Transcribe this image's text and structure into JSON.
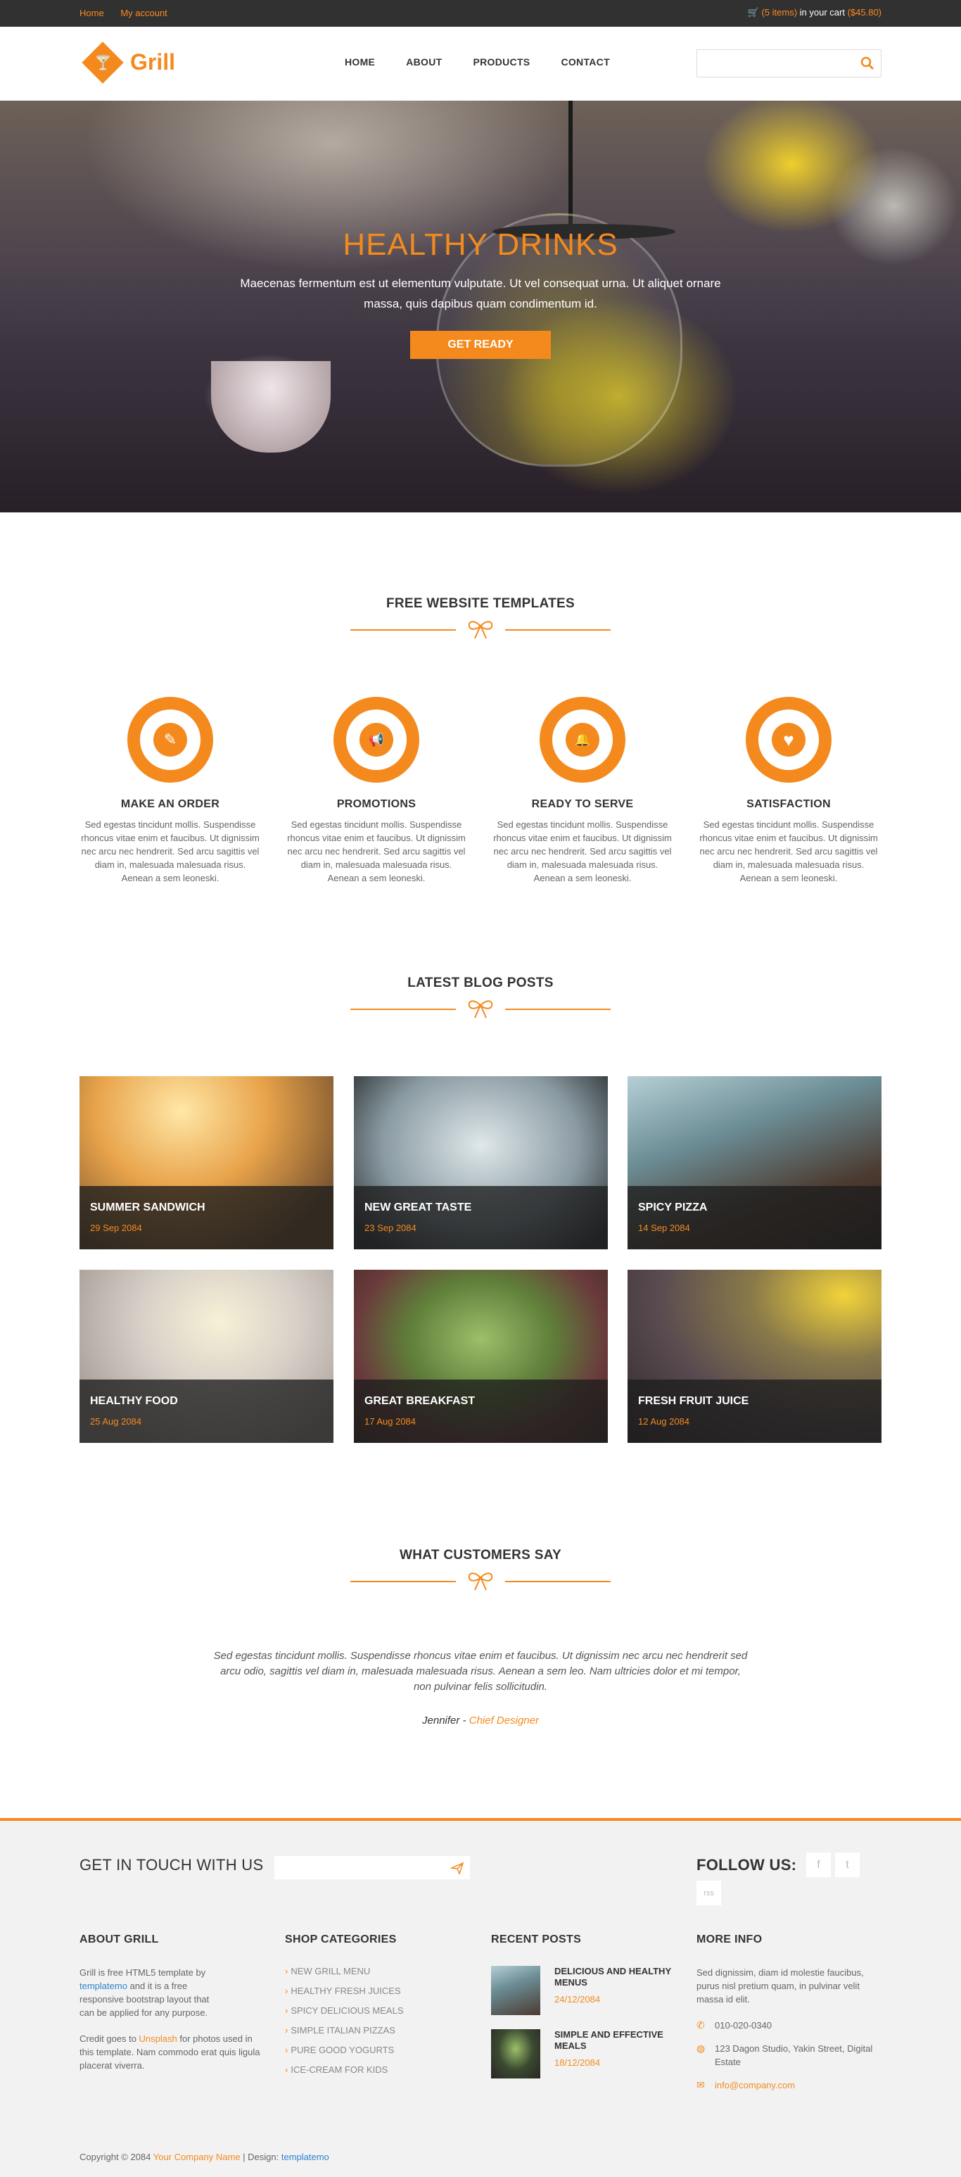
{
  "topbar": {
    "links": [
      "Home",
      "My account"
    ],
    "cart_prefix": "(5 items)",
    "cart_text": " in your cart ",
    "cart_amount": "($45.80)"
  },
  "header": {
    "logo_text": "Grill",
    "nav": [
      "HOME",
      "ABOUT",
      "PRODUCTS",
      "CONTACT"
    ],
    "search_placeholder": ""
  },
  "hero": {
    "title": "HEALTHY DRINKS",
    "text": "Maecenas fermentum est ut elementum vulputate. Ut vel consequat urna. Ut aliquet ornare massa, quis dapibus quam condimentum id.",
    "button": "GET READY"
  },
  "features": {
    "title": "FREE WEBSITE TEMPLATES",
    "items": [
      {
        "icon": "pencil-icon",
        "glyph": "✎",
        "title": "MAKE AN ORDER",
        "text": "Sed egestas tincidunt mollis. Suspendisse rhoncus vitae enim et faucibus. Ut dignissim nec arcu nec hendrerit. Sed arcu sagittis vel diam in, malesuada malesuada risus. Aenean a sem leoneski."
      },
      {
        "icon": "megaphone-icon",
        "glyph": "📢",
        "title": "PROMOTIONS",
        "text": "Sed egestas tincidunt mollis. Suspendisse rhoncus vitae enim et faucibus. Ut dignissim nec arcu nec hendrerit. Sed arcu sagittis vel diam in, malesuada malesuada risus. Aenean a sem leoneski."
      },
      {
        "icon": "bell-icon",
        "glyph": "🔔",
        "title": "READY TO SERVE",
        "text": "Sed egestas tincidunt mollis. Suspendisse rhoncus vitae enim et faucibus. Ut dignissim nec arcu nec hendrerit. Sed arcu sagittis vel diam in, malesuada malesuada risus. Aenean a sem leoneski."
      },
      {
        "icon": "heart-icon",
        "glyph": "♥",
        "title": "SATISFACTION",
        "text": "Sed egestas tincidunt mollis. Suspendisse rhoncus vitae enim et faucibus. Ut dignissim nec arcu nec hendrerit. Sed arcu sagittis vel diam in, malesuada malesuada risus. Aenean a sem leoneski."
      }
    ]
  },
  "blog": {
    "title": "LATEST BLOG POSTS",
    "posts": [
      {
        "title": "SUMMER SANDWICH",
        "date": "29 Sep 2084"
      },
      {
        "title": "NEW GREAT TASTE",
        "date": "23 Sep 2084"
      },
      {
        "title": "SPICY PIZZA",
        "date": "14 Sep 2084"
      },
      {
        "title": "HEALTHY FOOD",
        "date": "25 Aug 2084"
      },
      {
        "title": "GREAT BREAKFAST",
        "date": "17 Aug 2084"
      },
      {
        "title": "FRESH FRUIT JUICE",
        "date": "12 Aug 2084"
      }
    ]
  },
  "testimonial": {
    "title": "WHAT CUSTOMERS SAY",
    "quote": "Sed egestas tincidunt mollis. Suspendisse rhoncus vitae enim et faucibus. Ut dignissim nec arcu nec hendrerit sed arcu odio, sagittis vel diam in, malesuada malesuada risus. Aenean a sem leo. Nam ultricies dolor et mi tempor, non pulvinar felis sollicitudin.",
    "author": "Jennifer",
    "separator": " - ",
    "role": "Chief Designer"
  },
  "footer": {
    "touch_title": "GET IN TOUCH WITH US",
    "newsletter_placeholder": "",
    "follow_title": "FOLLOW US:",
    "social": [
      "f",
      "t",
      "rss"
    ],
    "about_title": "ABOUT GRILL",
    "about_p1_a": "Grill is free HTML5 template by ",
    "about_p1_link": "templatemo",
    "about_p1_b": " and it is a free responsive bootstrap layout that can be applied for any purpose.",
    "about_p2_a": "Credit goes to ",
    "about_p2_link": "Unsplash",
    "about_p2_b": " for photos used in this template. Nam commodo erat quis ligula placerat viverra.",
    "categories_title": "SHOP CATEGORIES",
    "categories": [
      "NEW GRILL MENU",
      "HEALTHY FRESH JUICES",
      "SPICY DELICIOUS MEALS",
      "SIMPLE ITALIAN PIZZAS",
      "PURE GOOD YOGURTS",
      "ICE-CREAM FOR KIDS"
    ],
    "recent_title": "RECENT POSTS",
    "recent": [
      {
        "title": "DELICIOUS AND HEALTHY MENUS",
        "date": "24/12/2084"
      },
      {
        "title": "SIMPLE AND EFFECTIVE MEALS",
        "date": "18/12/2084"
      }
    ],
    "more_title": "MORE INFO",
    "more_text": "Sed dignissim, diam id molestie faucibus, purus nisl pretium quam, in pulvinar velit massa id elit.",
    "phone": "010-020-0340",
    "address": "123 Dagon Studio, Yakin Street, Digital Estate",
    "email": "info@company.com",
    "copyright_a": "Copyright © 2084 ",
    "copyright_company": "Your Company Name",
    "copyright_b": " | Design: ",
    "copyright_design": "templatemo"
  },
  "colors": {
    "accent": "#f48a1e",
    "topbar": "#313131",
    "footer_bg": "#f2f2f2",
    "link": "#2c84ce"
  }
}
